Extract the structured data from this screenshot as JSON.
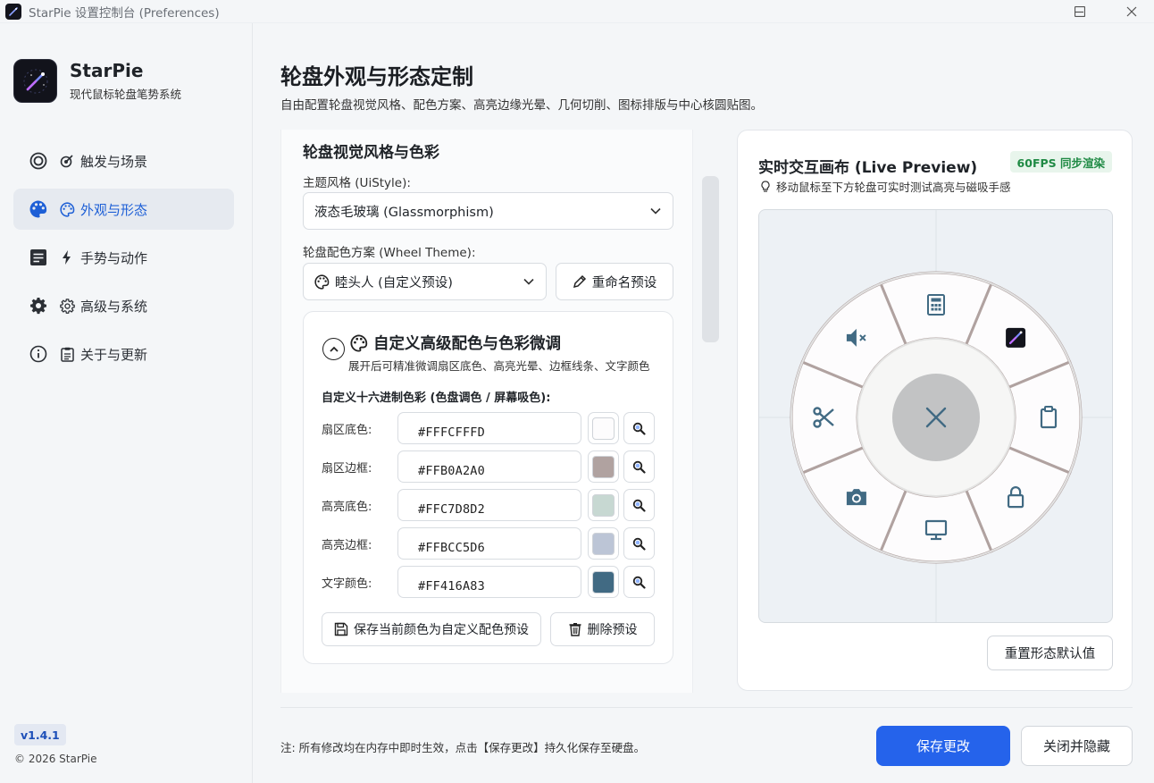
{
  "window": {
    "title": "StarPie 设置控制台 (Preferences)"
  },
  "sidebar": {
    "brand_name": "StarPie",
    "brand_sub": "现代鼠标轮盘笔势系统",
    "items": [
      {
        "label": "触发与场景",
        "icon": "target-icon",
        "active": false
      },
      {
        "label": "外观与形态",
        "icon": "palette-icon",
        "active": true
      },
      {
        "label": "手势与动作",
        "icon": "bolt-icon",
        "active": false
      },
      {
        "label": "高级与系统",
        "icon": "gear-icon",
        "active": false
      },
      {
        "label": "关于与更新",
        "icon": "info-icon",
        "active": false
      }
    ],
    "version": "v1.4.1",
    "copyright": "© 2026 StarPie"
  },
  "page": {
    "title": "轮盘外观与形态定制",
    "subtitle": "自由配置轮盘视觉风格、配色方案、高亮边缘光晕、几何切削、图标排版与中心核圆贴图。"
  },
  "visual": {
    "section_title": "轮盘视觉风格与色彩",
    "style_label": "主题风格 (UiStyle):",
    "style_value": "液态毛玻璃 (Glassmorphism)",
    "theme_label": "轮盘配色方案 (Wheel Theme):",
    "theme_value": "睦头人 (自定义预设)",
    "rename_button": "重命名预设"
  },
  "custom_colors": {
    "title": "自定义高级配色与色彩微调",
    "desc": "展开后可精准微调扇区底色、高亮光晕、边框线条、文字颜色",
    "sub_title": "自定义十六进制色彩 (色盘调色 / 屏幕吸色):",
    "rows": [
      {
        "label": "扇区底色:",
        "hex": "#FFFCFFFD",
        "color": "#fdfcfd"
      },
      {
        "label": "扇区边框:",
        "hex": "#FFB0A2A0",
        "color": "#b0a2a0"
      },
      {
        "label": "高亮底色:",
        "hex": "#FFC7D8D2",
        "color": "#c7d8d2"
      },
      {
        "label": "高亮边框:",
        "hex": "#FFBCC5D6",
        "color": "#bcc5d6"
      },
      {
        "label": "文字颜色:",
        "hex": "#FF416A83",
        "color": "#416a83"
      }
    ],
    "save_button": "保存当前颜色为自定义配色预设",
    "delete_button": "删除预设"
  },
  "preview": {
    "title": "实时交互画布 (Live Preview)",
    "badge": "60FPS 同步渲染",
    "hint": "移动鼠标至下方轮盘可实时测试高亮与磁吸手感",
    "reset_button": "重置形态默认值",
    "icon_color": "#416a83",
    "wedge_icons": [
      "calculator-icon",
      "starpie-app-icon",
      "clipboard-icon",
      "lock-icon",
      "monitor-icon",
      "camera-icon",
      "scissors-icon",
      "mute-icon"
    ]
  },
  "footer": {
    "note": "注: 所有修改均在内存中即时生效，点击【保存更改】持久化保存至硬盘。",
    "save_button": "保存更改",
    "close_button": "关闭并隐藏"
  },
  "colors": {
    "accent": "#2563eb",
    "active_nav_bg": "#e6eaf0",
    "badge_green": "#1f8a44"
  }
}
